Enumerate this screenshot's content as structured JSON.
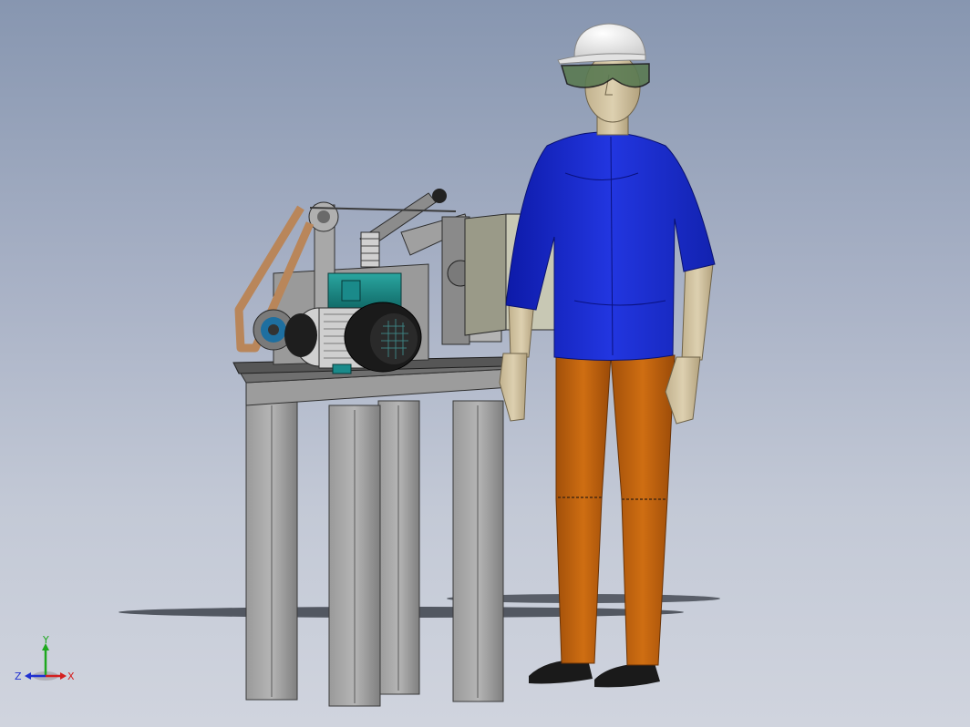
{
  "viewport": {
    "background_top": "#8796b0",
    "background_bottom": "#d0d4de"
  },
  "model": {
    "components": [
      {
        "name": "grinder-stand",
        "color": "#8a8a8a"
      },
      {
        "name": "electric-motor",
        "color": "#1d8a8a"
      },
      {
        "name": "abrasive-belt",
        "color": "#b9865a"
      },
      {
        "name": "control-box",
        "color": "#c8c8b4"
      },
      {
        "name": "operator-mannequin",
        "shirt_color": "#1b2bd6",
        "pants_color": "#c0620c",
        "helmet_color": "#f2f2f2"
      }
    ]
  },
  "triad": {
    "y_label": "Y",
    "x_label": "X",
    "z_label": "Z",
    "y_color": "#1ea81e",
    "x_color": "#d42020",
    "z_color": "#2030d0"
  }
}
